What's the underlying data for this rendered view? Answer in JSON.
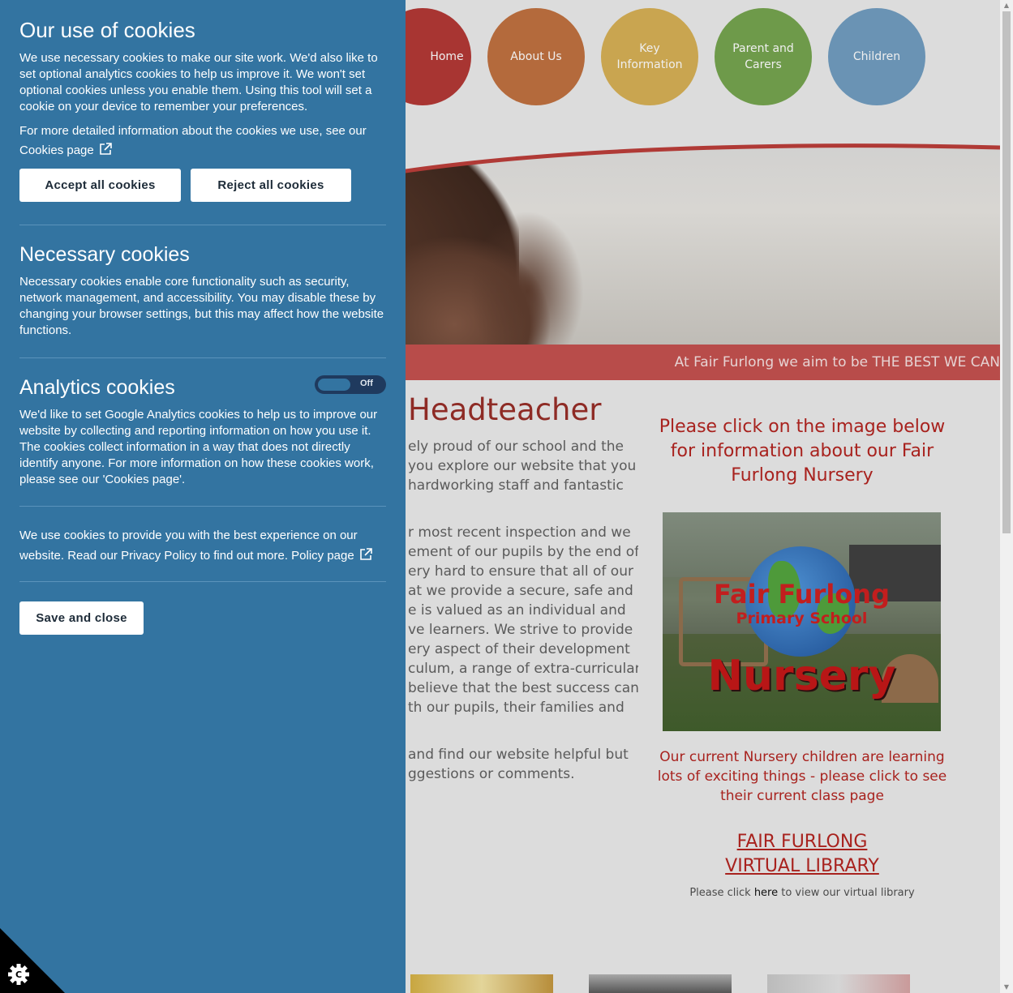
{
  "nav": {
    "items": [
      {
        "label": "Home",
        "color": "#a83532"
      },
      {
        "label": "About Us",
        "color": "#b46a3c"
      },
      {
        "label": "Key Information",
        "color": "#c9a550"
      },
      {
        "label": "Parent and Carers",
        "color": "#6e9a4a"
      },
      {
        "label": "Children",
        "color": "#6a93b4"
      }
    ]
  },
  "banner": {
    "text": "At Fair Furlong we aim to be THE BEST WE CAN"
  },
  "welcome": {
    "heading": "Headteacher",
    "para1": [
      "ely proud of our school and the",
      "you explore our website that you",
      "hardworking staff and fantastic"
    ],
    "para2": [
      "r most recent inspection and we",
      "ement of our pupils by the end of",
      "ery hard to ensure that all of our",
      "at we provide a secure, safe and",
      "e is valued as an individual and",
      "ve learners.   We strive to provide",
      "ery aspect of their development",
      "culum, a range of extra-curricular",
      "believe that the best success can",
      "th our pupils, their families and"
    ],
    "para3": [
      "and find our website helpful but",
      "ggestions or comments."
    ]
  },
  "nursery": {
    "heading": "Please click on the image below for information about our Fair Furlong Nursery",
    "image_title": "Fair Furlong",
    "image_subtitle": "Primary School",
    "image_word": "Nursery",
    "caption": "Our current Nursery children are learning lots of exciting things - please click to see their current class page"
  },
  "library": {
    "link_line1": "FAIR FURLONG",
    "link_line2": "VIRTUAL LIBRARY",
    "note_before": "Please click ",
    "note_link": "here",
    "note_after": " to view our virtual library"
  },
  "cookies": {
    "title": "Our use of cookies",
    "intro": "We use necessary cookies to make our site work. We'd also like to set optional analytics cookies to help us improve it. We won't set optional cookies unless you enable them. Using this tool will set a cookie on your device to remember your preferences.",
    "more_info": "For more detailed information about the cookies we use, see our",
    "cookies_page_link": "Cookies page",
    "accept_label": "Accept all cookies",
    "reject_label": "Reject all cookies",
    "necessary_title": "Necessary cookies",
    "necessary_text": "Necessary cookies enable core functionality such as security, network management, and accessibility. You may disable these by changing your browser settings, but this may affect how the website functions.",
    "analytics_title": "Analytics cookies",
    "analytics_toggle": "Off",
    "analytics_text": "We'd like to set Google Analytics cookies to help us to improve our website by collecting and reporting information on how you use it. The cookies collect information in a way that does not directly identify anyone. For more information on how these cookies work, please see our 'Cookies page'.",
    "privacy_text": "We use cookies to provide you with the best experience on our website. Read our Privacy Policy to find out more.",
    "policy_link": "Policy page",
    "save_label": "Save and close",
    "panel_color": "#3374a1"
  }
}
